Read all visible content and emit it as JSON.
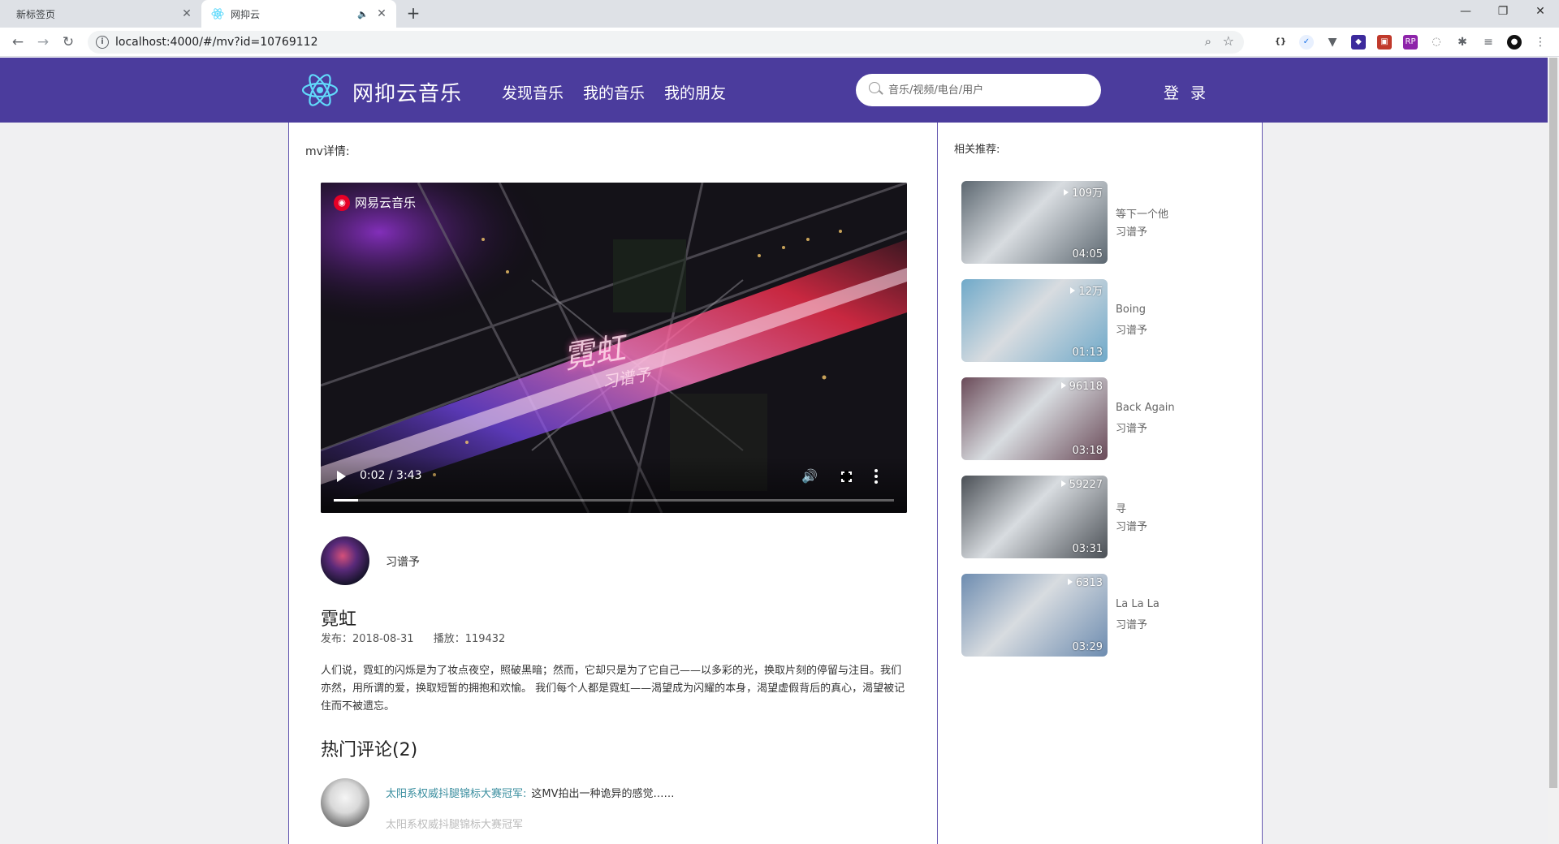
{
  "browser": {
    "tabs": [
      {
        "title": "新标签页",
        "active": false
      },
      {
        "title": "网抑云",
        "active": true
      }
    ],
    "url": "localhost:4000/#/mv?id=10769112"
  },
  "header": {
    "logo_text": "网抑云音乐",
    "nav": [
      "发现音乐",
      "我的音乐",
      "我的朋友"
    ],
    "search_placeholder": "音乐/视频/电台/用户",
    "login": "登 录"
  },
  "main": {
    "section_title": "mv详情:",
    "video": {
      "brand": "网易云音乐",
      "art_title": "霓虹",
      "art_subtitle": "习谱予",
      "time": "0:02 / 3:43",
      "progress": 0.009
    },
    "artist": "习谱予",
    "mv_name": "霓虹",
    "publish": "发布：2018-08-31",
    "plays": "播放：119432",
    "description": "人们说，霓虹的闪烁是为了妆点夜空，照破黑暗；然而，它却只是为了它自己——以多彩的光，换取片刻的停留与注目。我们亦然，用所谓的爱，换取短暂的拥抱和欢愉。 我们每个人都是霓虹——渴望成为闪耀的本身，渴望虚假背后的真心，渴望被记住而不被遗忘。",
    "comments_title": "热门评论(2)",
    "comments": [
      {
        "user": "太阳系权威抖腿锦标大赛冠军:",
        "text": "这MV拍出一种诡异的感觉……",
        "reply": "太阳系权威抖腿锦标大赛冠军"
      }
    ]
  },
  "sidebar": {
    "title": "相关推荐:",
    "items": [
      {
        "plays": "109万",
        "duration": "04:05",
        "title": "等下一个他",
        "artist": "习谱予",
        "color": "#5c6770"
      },
      {
        "plays": "12万",
        "duration": "01:13",
        "title": "Boing",
        "artist": "习谱予",
        "color": "#6fa9c9"
      },
      {
        "plays": "96118",
        "duration": "03:18",
        "title": "Back Again",
        "artist": "习谱予",
        "color": "#6a4a58"
      },
      {
        "plays": "59227",
        "duration": "03:31",
        "title": "寻",
        "artist": "习谱予",
        "color": "#4a4f55"
      },
      {
        "plays": "6313",
        "duration": "03:29",
        "title": "La La La",
        "artist": "习谱予",
        "color": "#6d8cb0"
      }
    ]
  },
  "colors": {
    "header_bg": "#4b3c9d",
    "panel_border": "#6558b0",
    "comment_user": "#3a8e9f"
  }
}
